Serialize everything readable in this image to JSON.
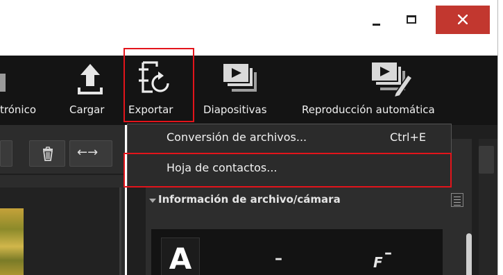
{
  "window": {
    "controls": {
      "minimize_icon": "minimize-icon",
      "maximize_icon": "maximize-icon",
      "close_icon": "close-icon",
      "close_color": "#c2372f"
    }
  },
  "toolbar": {
    "items": [
      {
        "label": "trónico",
        "icon": "mail-icon"
      },
      {
        "label": "Cargar",
        "icon": "upload-icon"
      },
      {
        "label": "Exportar",
        "icon": "export-icon"
      },
      {
        "label": "Diapositivas",
        "icon": "slideshow-icon"
      },
      {
        "label": "Reproducción automática",
        "icon": "auto-play-icon"
      }
    ],
    "bg_color": "#141414"
  },
  "left_panel": {
    "buttons": [
      {
        "icon": "trash-icon"
      },
      {
        "icon": "swap-arrows-icon",
        "label": "←→"
      }
    ]
  },
  "export_menu": {
    "items": [
      {
        "label": "Conversión de archivos...",
        "shortcut": "Ctrl+E"
      },
      {
        "label": "Hoja de contactos...",
        "shortcut": ""
      }
    ]
  },
  "info_panel": {
    "header": "Información de archivo/cámara",
    "mode_letter": "A",
    "value_1": "–",
    "value_2": "F",
    "value_2_suffix": "–"
  },
  "highlight_color": "#e3141b"
}
